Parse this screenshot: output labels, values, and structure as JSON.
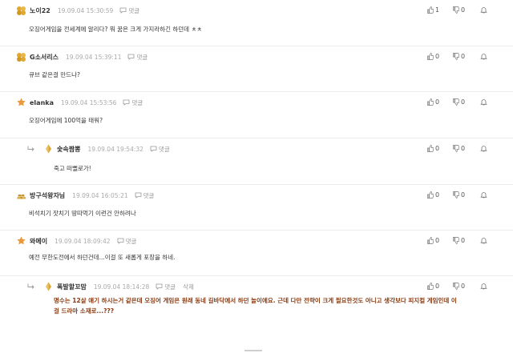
{
  "comments": [
    {
      "nick": "노이22",
      "time": "19.09.04 15:30:59",
      "reply_label": "댓글",
      "text": "오징어게임을 전세계에 알리다? 뭐 꿈은 크게 가지라하긴 하던데 ㅊㅊ",
      "likes": "1",
      "dislikes": "0",
      "medal": "gold-cluster",
      "medal_color": "#e0a82e"
    },
    {
      "nick": "G소서리스",
      "time": "19.09.04 15:39:11",
      "reply_label": "댓글",
      "text": "큐브 같은걸 만드나?",
      "likes": "0",
      "dislikes": "0",
      "medal": "gold-cluster",
      "medal_color": "#e0a82e"
    },
    {
      "nick": "elanka",
      "time": "19.09.04 15:53:56",
      "reply_label": "댓글",
      "text": "오징어게임에 100억을 태워?",
      "likes": "0",
      "dislikes": "0",
      "medal": "orange-star",
      "medal_color": "#e89a3c"
    },
    {
      "nick": "숯속짬뽕",
      "time": "19.09.04 19:54:32",
      "reply_label": "댓글",
      "text": "죽고 떠뻘로가!",
      "likes": "0",
      "dislikes": "0",
      "medal": "diamond",
      "medal_color": "#d9a63a"
    },
    {
      "nick": "방구석왕자님",
      "time": "19.09.04 16:05:21",
      "reply_label": "댓글",
      "text": "비석치기 잣치기 땅따먹기 이런건 안하려나",
      "likes": "0",
      "dislikes": "0",
      "medal": "gold-bars",
      "medal_color": "#c9952b"
    },
    {
      "nick": "와메이",
      "time": "19.09.04 18:09:42",
      "reply_label": "댓글",
      "text": "예전 무한도전에서 하던건데...이걸 또 새롭게 포장을 하네.",
      "likes": "0",
      "dislikes": "0",
      "medal": "orange-star",
      "medal_color": "#e89a3c"
    },
    {
      "nick": "폭발할꼬맘",
      "time": "19.09.04 18:14:28",
      "reply_label": "댓글",
      "delete_label": "삭제",
      "text": "명수는 12살 얘기 하시는거 같은데 오징어 게임은 원래 동네 길바닥에서 하던 놀이에요. 근데 다만 전략이 크게 필요한것도 아니고 생각보다 피지컬 게임인데 이걸 드라마 소재로...???",
      "likes": "0",
      "dislikes": "0",
      "medal": "diamond",
      "medal_color": "#d9a63a"
    }
  ],
  "icons": {
    "like": "thumbs-up-icon",
    "dislike": "thumbs-down-icon",
    "report": "bell-icon",
    "reply": "speech-bubble-icon",
    "reply_arrow": "reply-arrow-icon"
  }
}
